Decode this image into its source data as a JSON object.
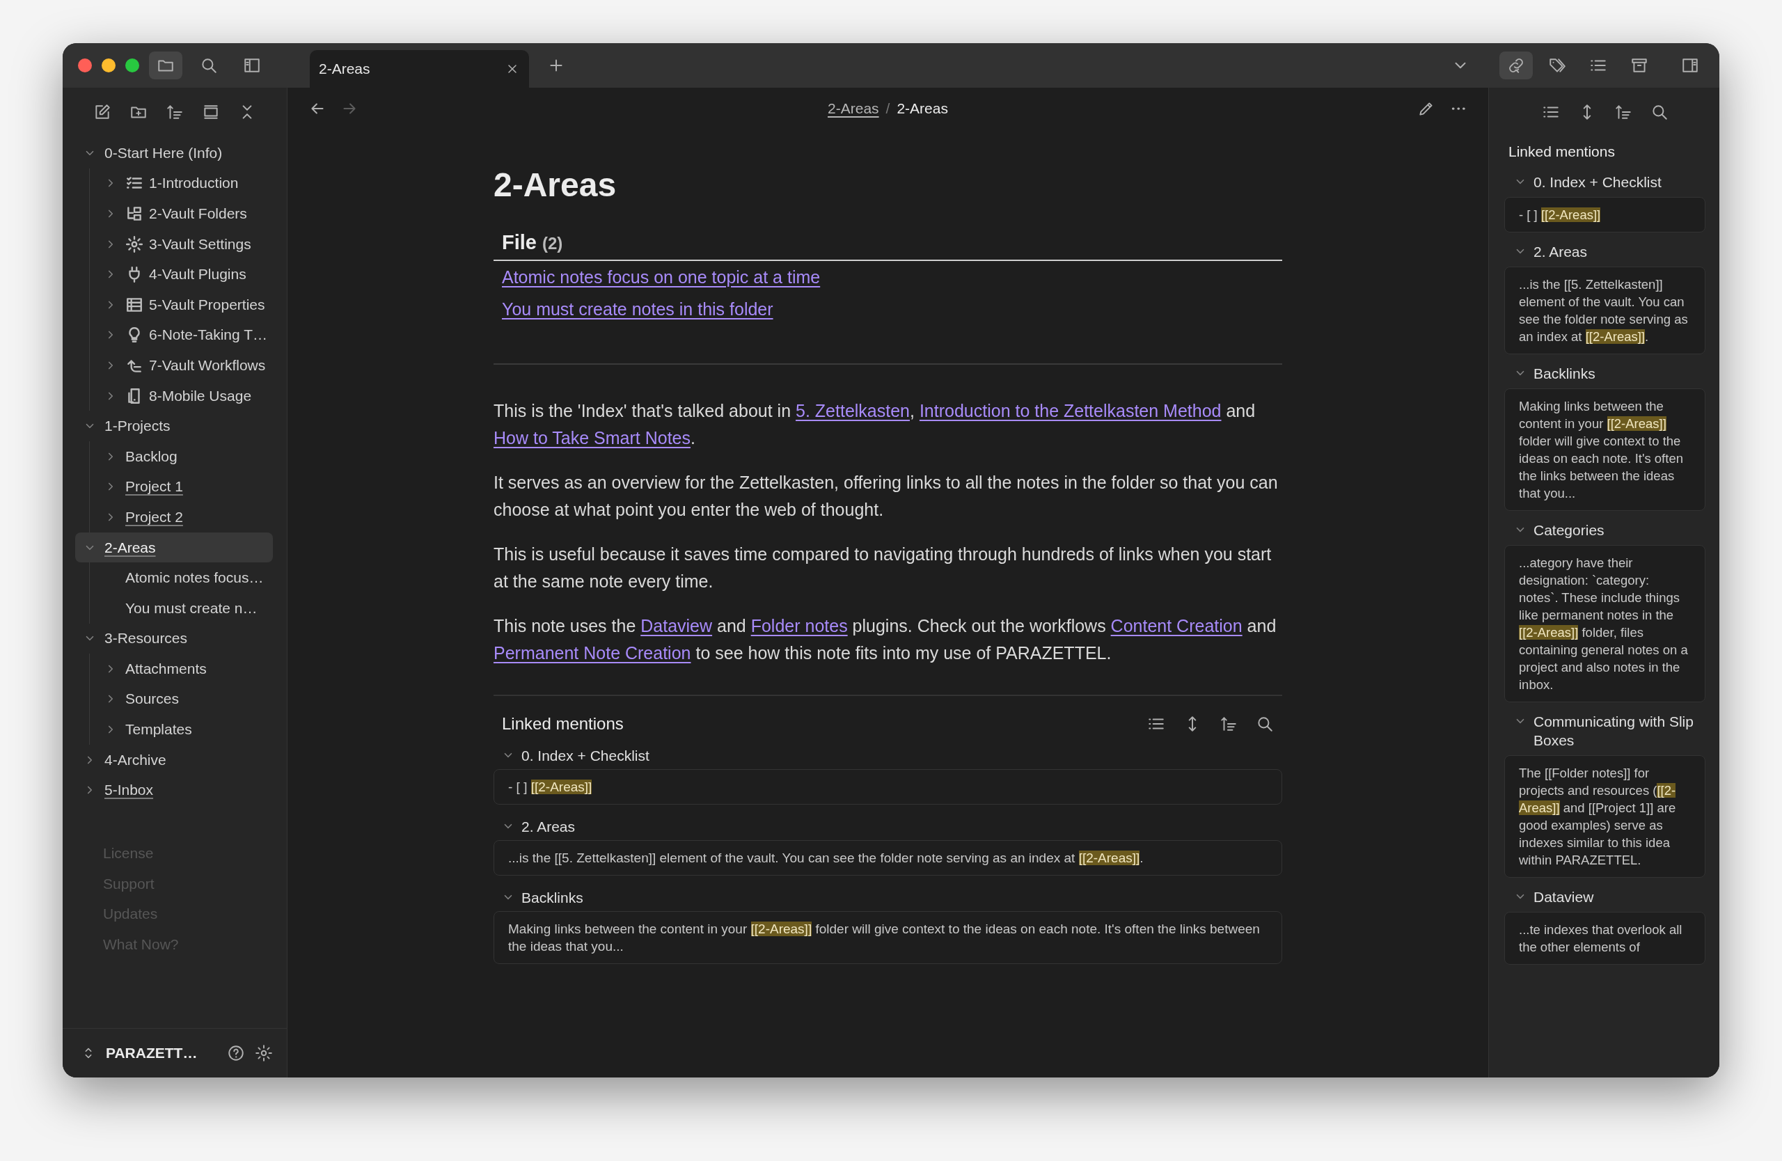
{
  "tabs": [
    {
      "label": "2-Areas",
      "selected": true
    }
  ],
  "breadcrumb": {
    "parent": "2-Areas",
    "separator": "/",
    "current": "2-Areas"
  },
  "sidebar": {
    "tree": [
      {
        "label": "0-Start Here (Info)",
        "kind": "folder",
        "expanded": true,
        "selected": false,
        "has_note": false,
        "children": [
          {
            "label": "1-Introduction",
            "kind": "folder",
            "expanded": false,
            "selected": false,
            "has_note": false
          },
          {
            "label": "2-Vault Folders",
            "kind": "folder",
            "expanded": false,
            "selected": false,
            "has_note": false
          },
          {
            "label": "3-Vault Settings",
            "kind": "folder",
            "expanded": false,
            "selected": false,
            "has_note": false
          },
          {
            "label": "4-Vault Plugins",
            "kind": "folder",
            "expanded": false,
            "selected": false,
            "has_note": false
          },
          {
            "label": "5-Vault Properties",
            "kind": "folder",
            "expanded": false,
            "selected": false,
            "has_note": false
          },
          {
            "label": "6-Note-Taking T…",
            "kind": "folder",
            "expanded": false,
            "selected": false,
            "has_note": false
          },
          {
            "label": "7-Vault Workflows",
            "kind": "folder",
            "expanded": false,
            "selected": false,
            "has_note": false
          },
          {
            "label": "8-Mobile Usage",
            "kind": "folder",
            "expanded": false,
            "selected": false,
            "has_note": false
          }
        ]
      },
      {
        "label": "1-Projects",
        "kind": "folder",
        "expanded": true,
        "selected": false,
        "has_note": false,
        "children": [
          {
            "label": "Backlog",
            "kind": "folder",
            "expanded": false,
            "selected": false,
            "has_note": false
          },
          {
            "label": "Project 1",
            "kind": "folder",
            "expanded": false,
            "selected": false,
            "has_note": true
          },
          {
            "label": "Project 2",
            "kind": "folder",
            "expanded": false,
            "selected": false,
            "has_note": true
          }
        ]
      },
      {
        "label": "2-Areas",
        "kind": "folder",
        "expanded": true,
        "selected": true,
        "has_note": true,
        "children": [
          {
            "label": "Atomic notes focus…",
            "kind": "file",
            "selected": false,
            "has_note": false
          },
          {
            "label": "You must create n…",
            "kind": "file",
            "selected": false,
            "has_note": false
          }
        ]
      },
      {
        "label": "3-Resources",
        "kind": "folder",
        "expanded": true,
        "selected": false,
        "has_note": false,
        "children": [
          {
            "label": "Attachments",
            "kind": "folder",
            "expanded": false,
            "selected": false,
            "has_note": false
          },
          {
            "label": "Sources",
            "kind": "folder",
            "expanded": false,
            "selected": false,
            "has_note": false
          },
          {
            "label": "Templates",
            "kind": "folder",
            "expanded": false,
            "selected": false,
            "has_note": false
          }
        ]
      },
      {
        "label": "4-Archive",
        "kind": "folder",
        "expanded": false,
        "selected": false,
        "has_note": false
      },
      {
        "label": "5-Inbox",
        "kind": "folder",
        "expanded": false,
        "selected": false,
        "has_note": true
      }
    ],
    "links": [
      "License",
      "Support",
      "Updates",
      "What Now?"
    ],
    "vault": "PARAZETT…"
  },
  "note": {
    "title": "2-Areas",
    "file_table": {
      "heading": "File",
      "count": "(2)",
      "rows": [
        "Atomic notes focus on one topic at a time",
        "You must create notes in this folder"
      ]
    },
    "paragraphs": [
      [
        {
          "text": "This is the 'Index' that's talked about in ",
          "link": false
        },
        {
          "text": "5. Zettelkasten",
          "link": true
        },
        {
          "text": ", ",
          "link": false
        },
        {
          "text": "Introduction to the Zettelkasten Method",
          "link": true
        },
        {
          "text": " and ",
          "link": false
        },
        {
          "text": "How to Take Smart Notes",
          "link": true
        },
        {
          "text": ".",
          "link": false
        }
      ],
      [
        {
          "text": "It serves as an overview for the Zettelkasten, offering links to all the notes in the folder so that you can choose at what point you enter the web of thought.",
          "link": false
        }
      ],
      [
        {
          "text": "This is useful because it saves time compared to navigating through hundreds of links when you start at the same note every time.",
          "link": false
        }
      ],
      [
        {
          "text": "This note uses the ",
          "link": false
        },
        {
          "text": "Dataview",
          "link": true
        },
        {
          "text": " and ",
          "link": false
        },
        {
          "text": "Folder notes",
          "link": true
        },
        {
          "text": " plugins. Check out the workflows ",
          "link": false
        },
        {
          "text": "Content Creation",
          "link": true
        },
        {
          "text": " and ",
          "link": false
        },
        {
          "text": "Permanent Note Creation",
          "link": true
        },
        {
          "text": " to see how this note fits into my use of PARAZETTEL.",
          "link": false
        }
      ]
    ],
    "linked_mentions": {
      "title": "Linked mentions",
      "groups": [
        {
          "title": "0. Index + Checklist",
          "expanded": true,
          "snippet": [
            {
              "text": "- [ ] ",
              "highlight": false
            },
            {
              "text": "[[2-Areas]]",
              "highlight": true
            }
          ]
        },
        {
          "title": "2. Areas",
          "expanded": true,
          "snippet": [
            {
              "text": "...is the [[5. Zettelkasten]] element of the vault. You can see the folder note serving as an index at ",
              "highlight": false
            },
            {
              "text": "[[2-Areas]]",
              "highlight": true
            },
            {
              "text": ".",
              "highlight": false
            }
          ]
        },
        {
          "title": "Backlinks",
          "expanded": true,
          "snippet": [
            {
              "text": "Making links between the content in your ",
              "highlight": false
            },
            {
              "text": "[[2-Areas]]",
              "highlight": true
            },
            {
              "text": " folder will give context to the ideas on each note. It's often the links between the ideas that you...",
              "highlight": false
            }
          ]
        }
      ]
    }
  },
  "right_panel": {
    "title": "Linked mentions",
    "groups": [
      {
        "title": "0. Index + Checklist",
        "expanded": true,
        "snippet": [
          {
            "text": "- [ ] ",
            "highlight": false
          },
          {
            "text": "[[2-Areas]]",
            "highlight": true
          }
        ]
      },
      {
        "title": "2. Areas",
        "expanded": true,
        "snippet": [
          {
            "text": "...is the [[5. Zettelkasten]] element of the vault. You can see the folder note serving as an index at ",
            "highlight": false
          },
          {
            "text": "[[2-Areas]]",
            "highlight": true
          },
          {
            "text": ".",
            "highlight": false
          }
        ]
      },
      {
        "title": "Backlinks",
        "expanded": true,
        "snippet": [
          {
            "text": "Making links between the content in your ",
            "highlight": false
          },
          {
            "text": "[[2-Areas]]",
            "highlight": true
          },
          {
            "text": " folder will give context to the ideas on each note. It's often the links between the ideas that you...",
            "highlight": false
          }
        ]
      },
      {
        "title": "Categories",
        "expanded": true,
        "snippet": [
          {
            "text": "...ategory have their designation: `category: notes`. These include things like permanent notes in the ",
            "highlight": false
          },
          {
            "text": "[[2-Areas]]",
            "highlight": true
          },
          {
            "text": " folder, files containing general notes on a project and also notes in the inbox.",
            "highlight": false
          }
        ]
      },
      {
        "title": "Communicating with Slip Boxes",
        "expanded": true,
        "snippet": [
          {
            "text": "The [[Folder notes]] for projects and resources (",
            "highlight": false
          },
          {
            "text": "[[2-Areas]]",
            "highlight": true
          },
          {
            "text": " and [[Project 1]] are good examples) serve as indexes similar to this idea within PARAZETTEL.",
            "highlight": false
          }
        ]
      },
      {
        "title": "Dataview",
        "expanded": true,
        "snippet": [
          {
            "text": "...te indexes that overlook all the other elements of",
            "highlight": false
          }
        ]
      }
    ]
  }
}
